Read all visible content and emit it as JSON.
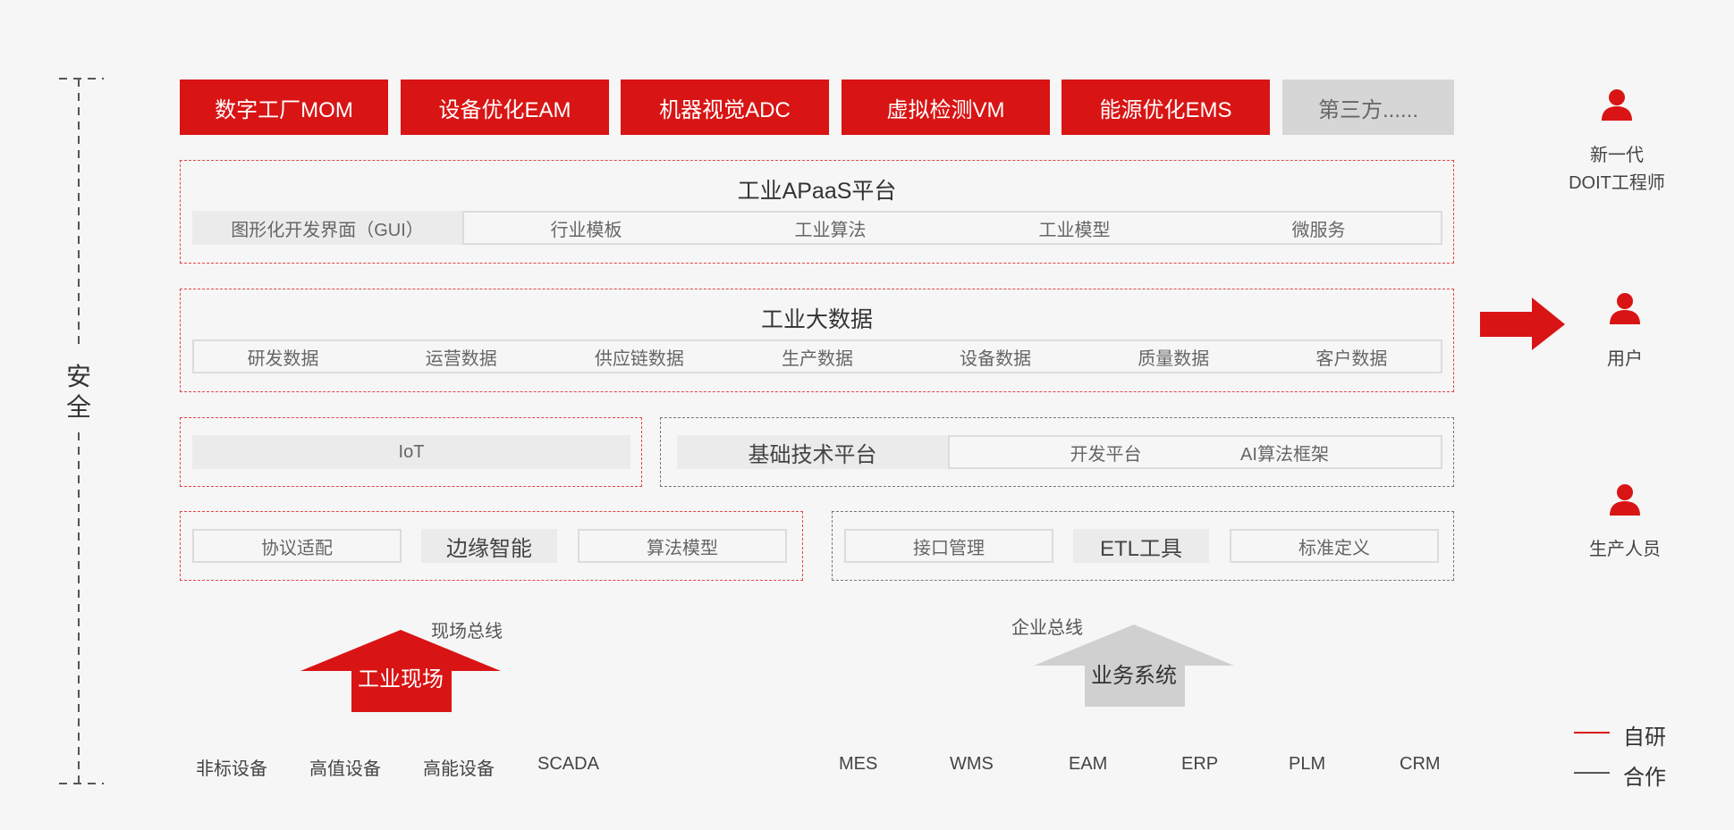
{
  "security": "安全",
  "apps": [
    {
      "label": "数字工厂MOM"
    },
    {
      "label": "设备优化EAM"
    },
    {
      "label": "机器视觉ADC"
    },
    {
      "label": "虚拟检测VM"
    },
    {
      "label": "能源优化EMS"
    },
    {
      "label": "第三方......"
    }
  ],
  "apaas": {
    "title": "工业APaaS平台",
    "gui": "图形化开发界面（GUI）",
    "items": [
      "行业模板",
      "工业算法",
      "工业模型",
      "微服务"
    ]
  },
  "bigdata": {
    "title": "工业大数据",
    "items": [
      "研发数据",
      "运营数据",
      "供应链数据",
      "生产数据",
      "设备数据",
      "质量数据",
      "客户数据"
    ]
  },
  "iot": "IoT",
  "base": {
    "title": "基础技术平台",
    "items": [
      "开发平台",
      "AI算法框架"
    ]
  },
  "edge": {
    "left": "协议适配",
    "center": "边缘智能",
    "right": "算法模型"
  },
  "etl": {
    "left": "接口管理",
    "center": "ETL工具",
    "right": "标准定义"
  },
  "field": {
    "bus": "现场总线",
    "label": "工业现场",
    "devices": [
      "非标设备",
      "高值设备",
      "高能设备",
      "SCADA"
    ]
  },
  "business": {
    "bus": "企业总线",
    "label": "业务系统",
    "systems": [
      "MES",
      "WMS",
      "EAM",
      "ERP",
      "PLM",
      "CRM"
    ]
  },
  "users": [
    {
      "line1": "新一代",
      "line2": "DOIT工程师"
    },
    {
      "line1": "用户",
      "line2": ""
    },
    {
      "line1": "生产人员",
      "line2": ""
    }
  ],
  "legend": {
    "self": "自研",
    "partner": "合作",
    "self_color": "#d91414",
    "partner_color": "#555555"
  }
}
